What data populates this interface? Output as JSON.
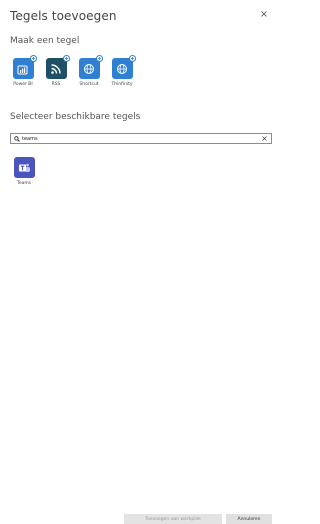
{
  "dialog": {
    "title": "Tegels toevoegen",
    "close_label": "×"
  },
  "make_tile": {
    "heading": "Maak een tegel",
    "tiles": [
      {
        "label": "Power BI",
        "icon": "power-bi-icon",
        "color": "#2f7fd2"
      },
      {
        "label": "RSS",
        "icon": "rss-icon",
        "color": "#1d4f66"
      },
      {
        "label": "Shortcut",
        "icon": "globe-icon",
        "color": "#2f7fd2"
      },
      {
        "label": "Thinfinity",
        "icon": "globe-icon",
        "color": "#2f7fd2"
      }
    ]
  },
  "select_tiles": {
    "heading": "Selecteer beschikbare tegels",
    "search": {
      "value": "teams",
      "clear_label": "×"
    },
    "results": [
      {
        "label": "Teams",
        "icon": "teams-icon",
        "color": "#4b53bc"
      }
    ]
  },
  "footer": {
    "add_label": "Toevoegen aan werkplek",
    "cancel_label": "Annuleren"
  }
}
